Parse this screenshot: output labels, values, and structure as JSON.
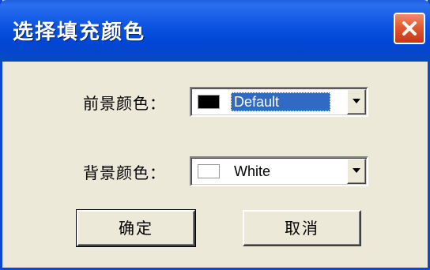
{
  "window": {
    "title": "选择填充颜色"
  },
  "foreground": {
    "label": "前景颜色：",
    "value": "Default",
    "swatch_color": "#000000"
  },
  "background": {
    "label": "背景颜色：",
    "value": "White",
    "swatch_color": "#ffffff"
  },
  "buttons": {
    "ok": "确定",
    "cancel": "取消"
  },
  "icons": {
    "close": "close-icon",
    "dropdown": "chevron-down-icon"
  },
  "colors": {
    "titlebar": "#0046d6",
    "selection": "#316ac5",
    "close_button": "#e35a30",
    "dialog_face": "#ece9d8"
  }
}
